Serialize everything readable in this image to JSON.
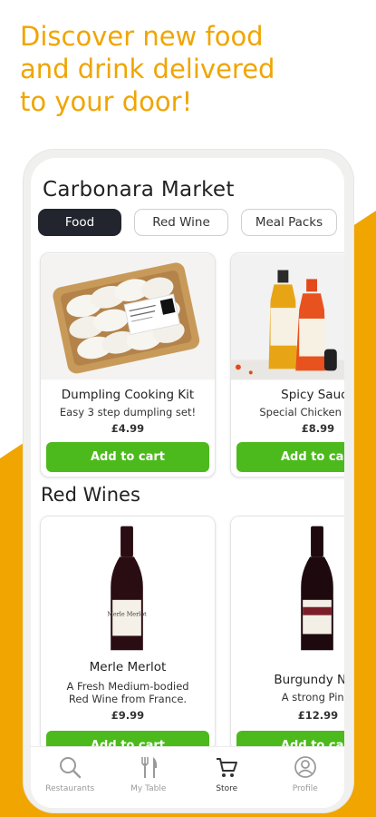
{
  "promo": {
    "line1": "Discover new food",
    "line2": "and drink delivered",
    "line3": "to your door!",
    "accent_color": "#f0a500"
  },
  "store": {
    "title": "Carbonara Market"
  },
  "categories": [
    {
      "label": "Food",
      "active": true
    },
    {
      "label": "Red Wine",
      "active": false
    },
    {
      "label": "Meal Packs",
      "active": false
    }
  ],
  "food_products": [
    {
      "name": "Dumpling Cooking Kit",
      "description": "Easy 3 step dumpling set!",
      "price": "£4.99",
      "button": "Add to cart",
      "image": "dumpling-kit-tray"
    },
    {
      "name": "Spicy Sauce",
      "description": "Special Chicken Sauce",
      "price": "£8.99",
      "button": "Add to cart",
      "image": "hot-sauce-bottles"
    }
  ],
  "section": {
    "red_wines_title": "Red Wines"
  },
  "wine_products": [
    {
      "name": "Merle Merlot",
      "description_line1": "A Fresh Medium-bodied",
      "description_line2": "Red Wine from France.",
      "price": "£9.99",
      "button": "Add to cart",
      "image": "wine-bottle-merlot",
      "label_text": "Merle Merlot"
    },
    {
      "name": "Burgundy Noir",
      "description_line1": "A strong Pinot",
      "description_line2": "",
      "price": "£12.99",
      "button": "Add to cart",
      "image": "wine-bottle-burgundy"
    }
  ],
  "tabbar": [
    {
      "label": "Restaurants",
      "icon": "search-icon",
      "active": false
    },
    {
      "label": "My Table",
      "icon": "cutlery-icon",
      "active": false
    },
    {
      "label": "Store",
      "icon": "cart-icon",
      "active": true
    },
    {
      "label": "Profile",
      "icon": "profile-icon",
      "active": false
    }
  ],
  "colors": {
    "cart_button": "#4cba1c",
    "active_chip": "#22252e"
  }
}
